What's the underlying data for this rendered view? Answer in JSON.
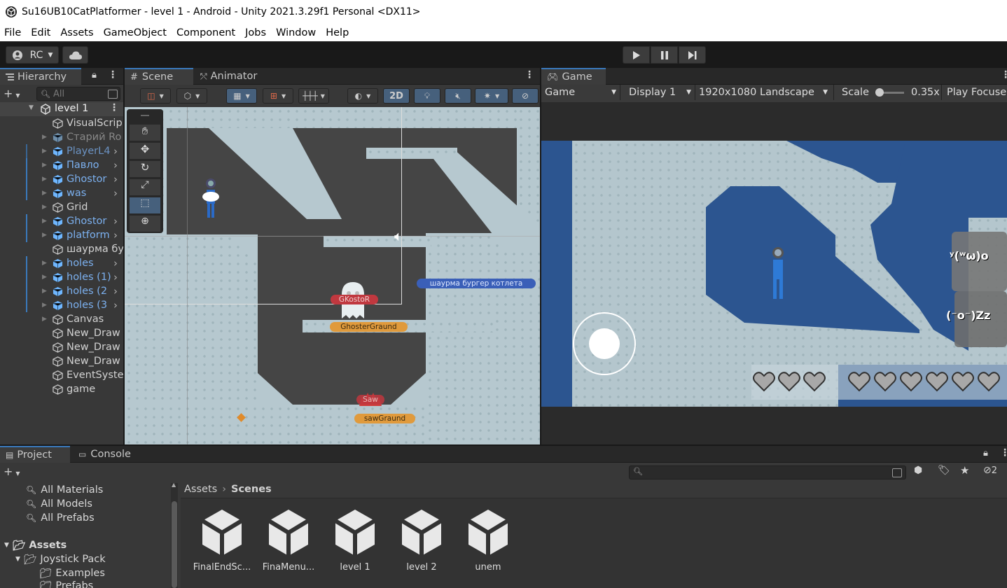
{
  "window": {
    "title": "Su16UB10CatPlatformer - level 1 - Android - Unity 2021.3.29f1 Personal <DX11>"
  },
  "menu": [
    "File",
    "Edit",
    "Assets",
    "GameObject",
    "Component",
    "Jobs",
    "Window",
    "Help"
  ],
  "toolbar": {
    "account_label": "RC"
  },
  "hierarchy": {
    "tab": "Hierarchy",
    "search_placeholder": "All",
    "scene": "level 1",
    "items": [
      {
        "label": "VisualScrip",
        "style": "normal",
        "expand": false,
        "prefab": false,
        "more": false
      },
      {
        "label": "Старий Ro",
        "style": "grey",
        "expand": true,
        "prefab": true,
        "more": false
      },
      {
        "label": "PlayerL4",
        "style": "blue-dim",
        "expand": true,
        "prefab": true,
        "more": true
      },
      {
        "label": "Павло",
        "style": "blue",
        "expand": true,
        "prefab": true,
        "more": true
      },
      {
        "label": "Ghostor",
        "style": "blue",
        "expand": true,
        "prefab": true,
        "more": true
      },
      {
        "label": "was",
        "style": "blue",
        "expand": true,
        "prefab": true,
        "more": true
      },
      {
        "label": "Grid",
        "style": "normal",
        "expand": true,
        "prefab": false,
        "more": false
      },
      {
        "label": "Ghostor",
        "style": "blue",
        "expand": true,
        "prefab": true,
        "more": true
      },
      {
        "label": "platform",
        "style": "blue",
        "expand": true,
        "prefab": true,
        "more": true
      },
      {
        "label": "шаурма бу",
        "style": "normal",
        "expand": false,
        "prefab": false,
        "more": false
      },
      {
        "label": "holes",
        "style": "blue",
        "expand": true,
        "prefab": true,
        "more": true
      },
      {
        "label": "holes (1)",
        "style": "blue",
        "expand": true,
        "prefab": true,
        "more": true
      },
      {
        "label": "holes (2",
        "style": "blue",
        "expand": true,
        "prefab": true,
        "more": true
      },
      {
        "label": "holes (3",
        "style": "blue",
        "expand": true,
        "prefab": true,
        "more": true
      },
      {
        "label": "Canvas",
        "style": "normal",
        "expand": true,
        "prefab": false,
        "more": false
      },
      {
        "label": "New_Draw",
        "style": "normal",
        "expand": false,
        "prefab": false,
        "more": false
      },
      {
        "label": "New_Draw",
        "style": "normal",
        "expand": false,
        "prefab": false,
        "more": false
      },
      {
        "label": "New_Draw",
        "style": "normal",
        "expand": false,
        "prefab": false,
        "more": false
      },
      {
        "label": "EventSyste",
        "style": "normal",
        "expand": false,
        "prefab": false,
        "more": false
      },
      {
        "label": "game",
        "style": "normal",
        "expand": false,
        "prefab": false,
        "more": false
      }
    ]
  },
  "scene_view": {
    "tabs": [
      "Scene",
      "Animator"
    ],
    "mode_2d": "2D",
    "labels": {
      "ghost_tag": "GKostoR",
      "ghost_ground": "GhosterGraund",
      "shawarma": "шаурма бургер котлета",
      "saw_tag": "Saw",
      "saw_ground": "sawGraund"
    }
  },
  "game_view": {
    "tab": "Game",
    "mode": "Game",
    "display": "Display 1",
    "resolution": "1920x1080 Landscape",
    "scale_label": "Scale",
    "scale_value": "0.35x",
    "play_focus": "Play Focuse",
    "face_1": "ʸ(ʷω)o",
    "face_2": "(⁻o⁻)Zz",
    "player_hearts": 3,
    "boss_hearts": 6
  },
  "project": {
    "tabs": [
      "Project",
      "Console"
    ],
    "favorites": [
      "All Materials",
      "All Models",
      "All Prefabs"
    ],
    "tree": [
      "Assets",
      "Joystick Pack",
      "Examples",
      "Prefabs"
    ],
    "breadcrumb": [
      "Assets",
      "Scenes"
    ],
    "assets": [
      "FinalEndSc...",
      "FinaMenu...",
      "level 1",
      "level 2",
      "unem"
    ],
    "hidden_count": "2"
  },
  "colors": {
    "accent": "#3a79bb",
    "prefab_blue": "#7cb1f0",
    "ice": "#b6c8cf",
    "game_blue": "#2c5590"
  }
}
